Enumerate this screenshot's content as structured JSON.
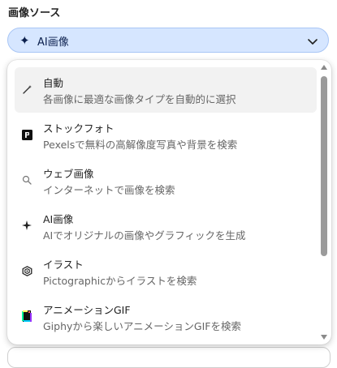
{
  "section": {
    "title": "画像ソース"
  },
  "select": {
    "icon": "sparkle-icon",
    "value": "AI画像"
  },
  "dropdown": {
    "options": [
      {
        "icon": "magic-wand-icon",
        "title": "自動",
        "description": "各画像に最適な画像タイプを自動的に選択",
        "selected": true
      },
      {
        "icon": "pexels-logo-icon",
        "title": "ストックフォト",
        "description": "Pexelsで無料の高解像度写真や背景を検索"
      },
      {
        "icon": "search-icon",
        "title": "ウェブ画像",
        "description": "インターネットで画像を検索"
      },
      {
        "icon": "sparkle-icon",
        "title": "AI画像",
        "description": "AIでオリジナルの画像やグラフィックを生成"
      },
      {
        "icon": "pictographic-logo-icon",
        "title": "イラスト",
        "description": "Pictographicからイラストを検索"
      },
      {
        "icon": "giphy-logo-icon",
        "title": "アニメーションGIF",
        "description": "Giphyから楽しいアニメーションGIFを検索"
      }
    ]
  },
  "colors": {
    "select_bg": "#d6e6ff",
    "select_border": "#a9c6f5",
    "select_text": "#0b1f4d"
  }
}
